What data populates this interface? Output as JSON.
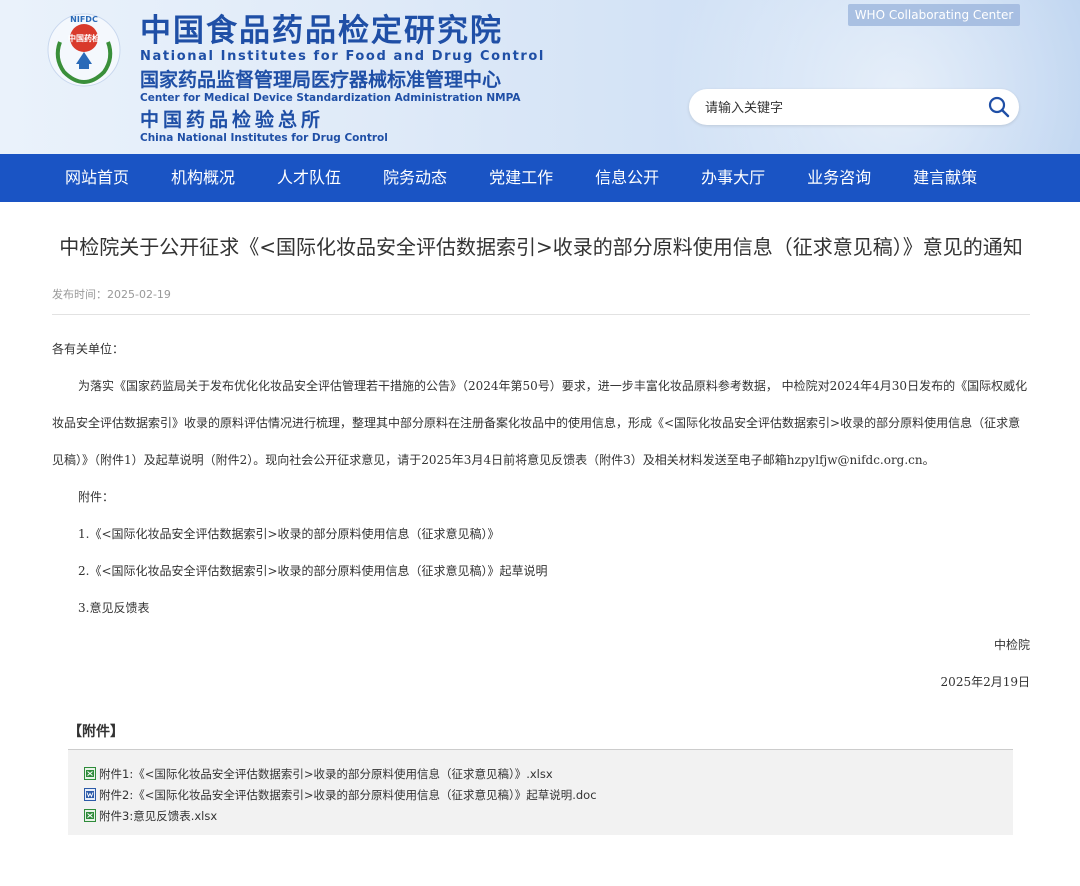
{
  "header": {
    "logo": {
      "ring_text": "NIFDC",
      "center_text": "中国药检",
      "icon": "nifdc-emblem-icon"
    },
    "title_cn": "中国食品药品检定研究院",
    "title_en": "National Institutes for Food and Drug Control",
    "sub_cn": "国家药品监督管理局医疗器械标准管理中心",
    "sub_en": "Center for Medical Device Standardization Administration NMPA",
    "cn2": "中国药品检验总所",
    "en2": "China National Institutes for Drug Control",
    "who_label": "WHO Collaborating Center",
    "search": {
      "placeholder": "请输入关键字",
      "icon": "search-icon"
    }
  },
  "nav": {
    "items": [
      "网站首页",
      "机构概况",
      "人才队伍",
      "院务动态",
      "党建工作",
      "信息公开",
      "办事大厅",
      "业务咨询",
      "建言献策"
    ]
  },
  "article": {
    "title": "中检院关于公开征求《<国际化妆品安全评估数据索引>收录的部分原料使用信息（征求意见稿）》意见的通知",
    "meta": "发布时间：2025-02-19",
    "salutation": "各有关单位：",
    "paragraph": "为落实《国家药监局关于发布优化化妆品安全评估管理若干措施的公告》（2024年第50号）要求，进一步丰富化妆品原料参考数据， 中检院对2024年4月30日发布的《国际权威化妆品安全评估数据索引》收录的原料评估情况进行梳理，整理其中部分原料在注册备案化妆品中的使用信息，形成《<国际化妆品安全评估数据索引>收录的部分原料使用信息（征求意见稿）》（附件1）及起草说明（附件2）。现向社会公开征求意见，请于2025年3月4日前将意见反馈表（附件3）及相关材料发送至电子邮箱hzpylfjw@nifdc.org.cn。",
    "attachments_label": "附件：",
    "attachment_lines": [
      "1.《<国际化妆品安全评估数据索引>收录的部分原料使用信息（征求意见稿）》",
      "2.《<国际化妆品安全评估数据索引>收录的部分原料使用信息（征求意见稿）》起草说明",
      "3.意见反馈表"
    ],
    "signature": "中检院",
    "date": "2025年2月19日"
  },
  "attachments": {
    "heading": "【附件】",
    "files": [
      {
        "name": "附件1:《<国际化妆品安全评估数据索引>收录的部分原料使用信息（征求意见稿）》.xlsx",
        "icon": "excel-file-icon",
        "color": "#2e8b3a"
      },
      {
        "name": "附件2:《<国际化妆品安全评估数据索引>收录的部分原料使用信息（征求意见稿）》起草说明.doc",
        "icon": "word-file-icon",
        "color": "#2b5aa8"
      },
      {
        "name": "附件3:意见反馈表.xlsx",
        "icon": "excel-file-icon",
        "color": "#2e8b3a"
      }
    ]
  },
  "colors": {
    "brand_blue": "#1f4fa6",
    "nav_blue": "#1a54c4",
    "meta_gray": "#999999"
  }
}
